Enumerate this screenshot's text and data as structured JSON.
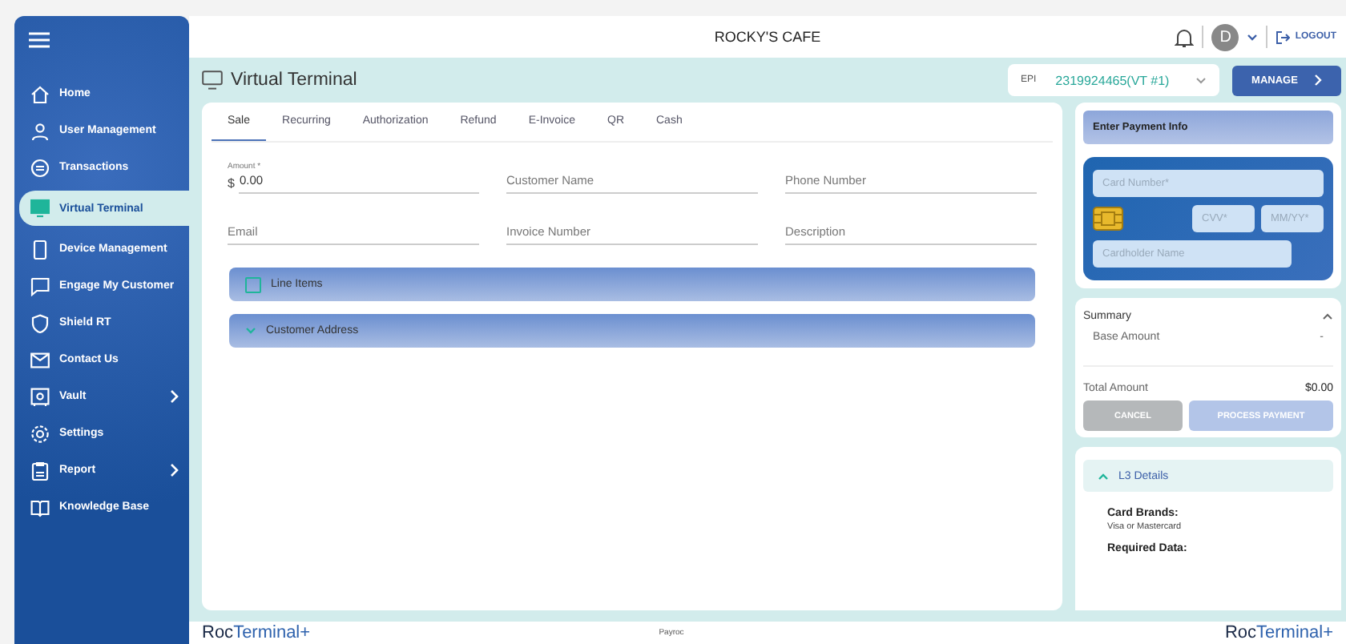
{
  "header": {
    "title": "ROCKY'S CAFE",
    "avatar": "D",
    "logout": "LOGOUT"
  },
  "sidebar": {
    "items": [
      {
        "label": "Home",
        "selected": false,
        "has_submenu": false
      },
      {
        "label": "User Management",
        "selected": false,
        "has_submenu": false
      },
      {
        "label": "Transactions",
        "selected": false,
        "has_submenu": false
      },
      {
        "label": "Virtual Terminal",
        "selected": true,
        "has_submenu": false
      },
      {
        "label": "Device Management",
        "selected": false,
        "has_submenu": false
      },
      {
        "label": "Engage My Customer",
        "selected": false,
        "has_submenu": false
      },
      {
        "label": "Shield RT",
        "selected": false,
        "has_submenu": false
      },
      {
        "label": "Contact Us",
        "selected": false,
        "has_submenu": false
      },
      {
        "label": "Vault",
        "selected": false,
        "has_submenu": true
      },
      {
        "label": "Settings",
        "selected": false,
        "has_submenu": false
      },
      {
        "label": "Report",
        "selected": false,
        "has_submenu": true
      },
      {
        "label": "Knowledge Base",
        "selected": false,
        "has_submenu": false
      }
    ]
  },
  "page": {
    "title": "Virtual Terminal",
    "epi_label": "EPI",
    "epi_value": "2319924465(VT #1)",
    "manage": "MANAGE"
  },
  "tabs": [
    {
      "label": "Sale",
      "selected": true
    },
    {
      "label": "Recurring",
      "selected": false
    },
    {
      "label": "Authorization",
      "selected": false
    },
    {
      "label": "Refund",
      "selected": false
    },
    {
      "label": "E-Invoice",
      "selected": false
    },
    {
      "label": "QR",
      "selected": false
    },
    {
      "label": "Cash",
      "selected": false
    }
  ],
  "fields": [
    {
      "label": "Amount *",
      "prefix": "$",
      "value": "0.00"
    },
    {
      "placeholder": "Customer Name"
    },
    {
      "placeholder": "Phone Number"
    },
    {
      "placeholder": "Email"
    },
    {
      "placeholder": "Invoice Number"
    },
    {
      "placeholder": "Description"
    }
  ],
  "sections": [
    {
      "label": "Line Items",
      "kind": "checkbox",
      "checked": false
    },
    {
      "label": "Customer Address",
      "kind": "expander",
      "expanded": false
    }
  ],
  "payment": {
    "title": "Enter Payment Info",
    "card_number_placeholder": "Card Number*",
    "cvv_placeholder": "CVV*",
    "expiry_placeholder": "MM/YY*",
    "cardholder_placeholder": "Cardholder Name"
  },
  "summary": {
    "title": "Summary",
    "expanded": true,
    "base_label": "Base Amount",
    "base_value": "-",
    "total_label": "Total Amount",
    "total_value": "$0.00",
    "cancel": "CANCEL",
    "process": "PROCESS PAYMENT"
  },
  "l3": {
    "title": "L3 Details",
    "expanded": true,
    "brands_label": "Card Brands:",
    "brands_value": "Visa or Mastercard",
    "required_label": "Required Data:"
  },
  "footer": {
    "left_logo": {
      "dark": "Roc",
      "light": "Terminal+"
    },
    "center": "Payroc",
    "right_logo": {
      "dark": "Roc",
      "light": "Terminal+"
    }
  }
}
